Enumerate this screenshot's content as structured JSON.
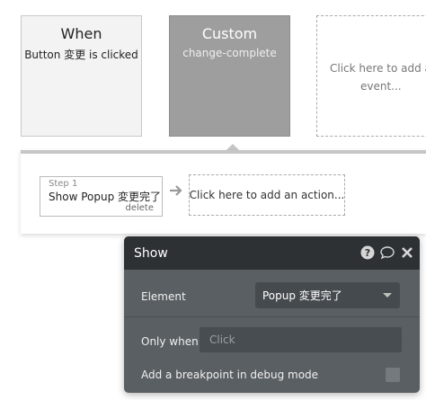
{
  "event_card": {
    "title": "When",
    "subtitle": "Button 変更 is clicked"
  },
  "custom_card": {
    "title": "Custom",
    "subtitle": "change-complete"
  },
  "add_event": {
    "line1": "Click here to add an",
    "line2": "event..."
  },
  "step": {
    "number": "Step 1",
    "name": "Show Popup 変更完了",
    "delete": "delete"
  },
  "add_action": {
    "label": "Click here to add an action..."
  },
  "popup": {
    "title": "Show",
    "icons": [
      "help-icon",
      "comment-icon",
      "close-icon"
    ],
    "element_label": "Element",
    "element_value": "Popup 変更完了",
    "only_when_label": "Only when",
    "only_when_placeholder": "Click",
    "debug_label": "Add a breakpoint in debug mode"
  },
  "colors": {
    "popup_bg": "#5a5f63",
    "popup_header": "#2d3134",
    "custom_card": "#9e9e9e"
  }
}
